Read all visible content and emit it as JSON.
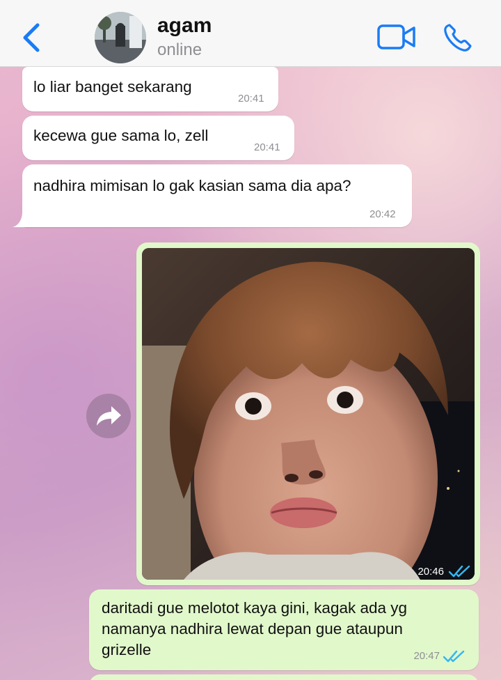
{
  "header": {
    "contact_name": "agam",
    "status": "online",
    "icons": {
      "back": "chevron-left-icon",
      "video": "video-camera-icon",
      "call": "phone-icon"
    },
    "accent_color": "#1a7cf5"
  },
  "messages": [
    {
      "direction": "incoming",
      "text": "lo liar banget sekarang",
      "time": "20:41"
    },
    {
      "direction": "incoming",
      "text": "kecewa gue sama lo, zell",
      "time": "20:41"
    },
    {
      "direction": "incoming",
      "text": "nadhira mimisan lo gak kasian sama dia apa?",
      "time": "20:42"
    },
    {
      "direction": "outgoing",
      "type": "photo",
      "time": "20:46",
      "status": "read"
    },
    {
      "direction": "outgoing",
      "lines": [
        "daritadi gue melotot kaya gini, kagak ada yg",
        "namanya nadhira lewat depan gue ataupun",
        "grizelle"
      ],
      "time": "20:47",
      "status": "read"
    }
  ],
  "colors": {
    "incoming_bubble": "#ffffff",
    "outgoing_bubble": "#e1f8cb",
    "read_check": "#34b7f1"
  }
}
